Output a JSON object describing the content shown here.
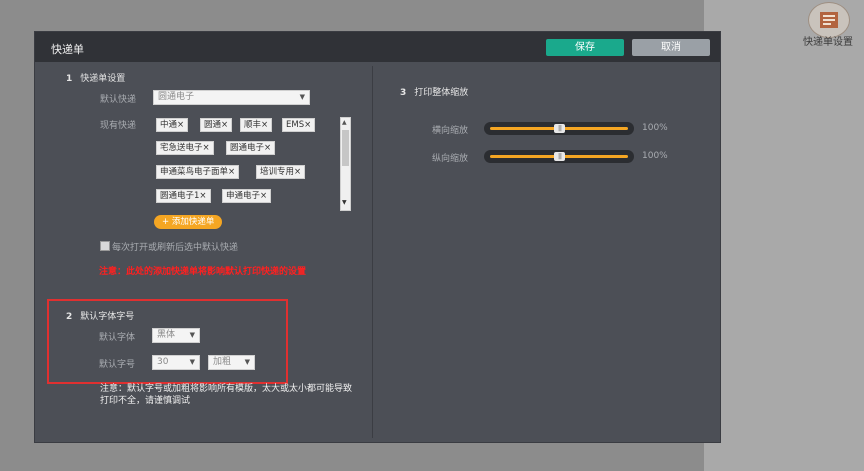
{
  "topbar": {
    "icon": "courier-list-icon",
    "label": "快递单设置"
  },
  "dialog": {
    "title": "快递单",
    "save_label": "保存",
    "cancel_label": "取消"
  },
  "section1": {
    "number": "1",
    "title": "快递单设置",
    "default_label": "默认快递",
    "default_value": "圆通电子",
    "existing_label": "现有快递",
    "couriers": [
      "中通×",
      "圆通×",
      "顺丰×",
      "EMS×",
      "宅急送电子×",
      "圆通电子×",
      "申通菜鸟电子面单×",
      "培训专用×",
      "圆通电子1×",
      "申通电子×"
    ],
    "add_label": "+ 添加快递单",
    "checkbox_label": "每次打开或刷新后选中默认快递",
    "warning": "注意：此处的添加快递单将影响默认打印快递的设置"
  },
  "section2": {
    "number": "2",
    "title": "默认字体字号",
    "font_label": "默认字体",
    "font_value": "黑体",
    "size_label": "默认字号",
    "size_value": "30",
    "weight_value": "加粗",
    "note": "注意：默认字号或加粗将影响所有模版，太大或太小都可能导致打印不全，请谨慎调试"
  },
  "section3": {
    "number": "3",
    "title": "打印整体缩放",
    "h_label": "横向缩放",
    "h_value": "100%",
    "h_level_percent": 50,
    "v_label": "纵向缩放",
    "v_value": "100%",
    "v_level_percent": 50
  },
  "colors": {
    "save": "#1aa98c",
    "cancel": "#9aa0a6",
    "accent": "#f5a623",
    "warning": "#ff2020",
    "highlight_frame": "#e03030"
  }
}
